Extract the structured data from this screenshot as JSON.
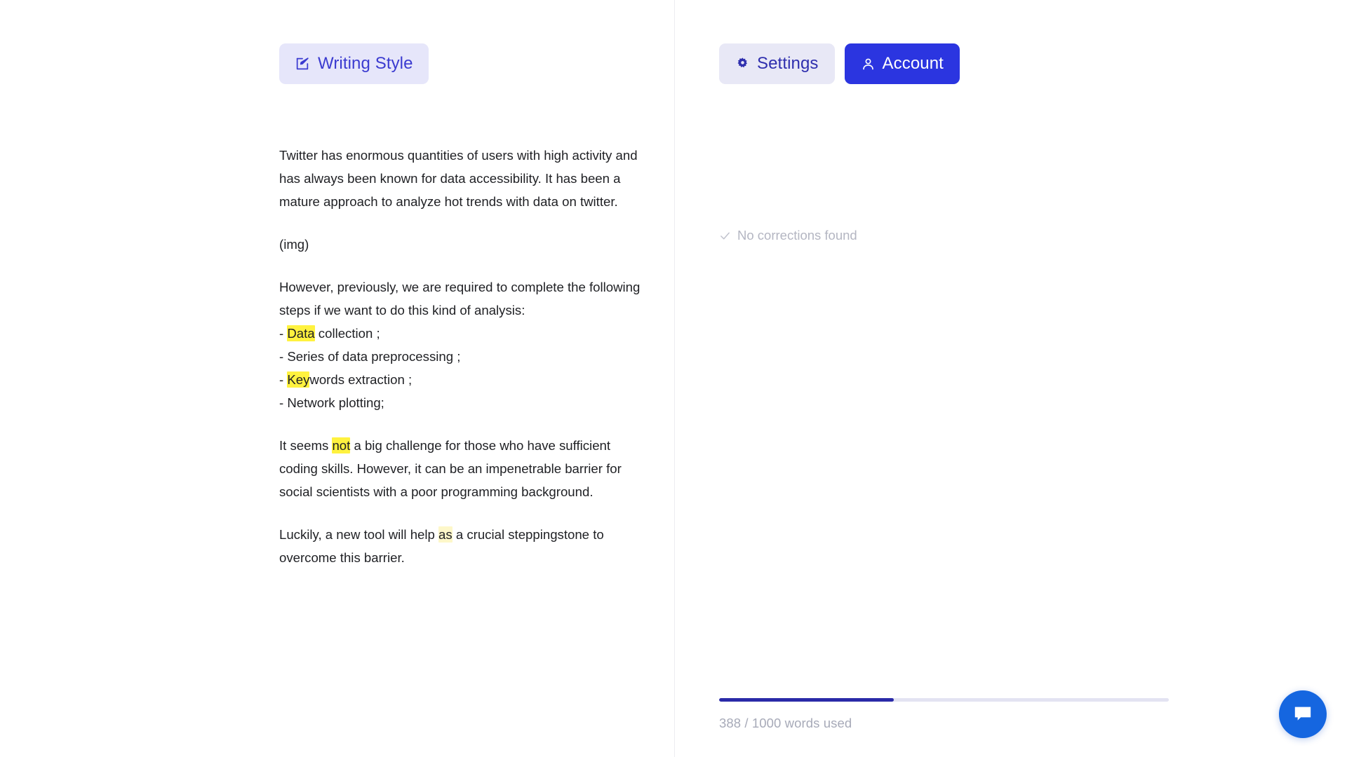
{
  "editor": {
    "writing_style_button": {
      "label": "Writing Style",
      "icon": "edit-square-icon"
    },
    "paragraphs": {
      "p1": "Twitter has enormous quantities of users with high activity and has always been known for data accessibility. It has been a mature approach to analyze hot trends with data on twitter.",
      "p2": "(img)",
      "p3_lead": "However, previously, we are required to complete the following steps if we want to do this kind of analysis:",
      "list": [
        {
          "bullet": "- ",
          "highlight": "Data",
          "rest": " collection ;"
        },
        {
          "bullet": "- ",
          "highlight": "",
          "rest": "Series of data preprocessing ;"
        },
        {
          "bullet": "- ",
          "highlight": "Key",
          "rest": "words extraction ;"
        },
        {
          "bullet": "- ",
          "highlight": "",
          "rest": "Network plotting;"
        }
      ],
      "p4_a": "It seems ",
      "p4_hl": "not",
      "p4_b": " a big challenge for those who have sufficient coding skills. However, it can be an impenetrable barrier for social scientists with a poor programming background.",
      "p5_a": "Luckily, a new tool will help ",
      "p5_hl": "as",
      "p5_b": " a crucial steppingstone to overcome this barrier."
    }
  },
  "sidebar": {
    "settings_button": {
      "label": "Settings",
      "icon": "gear-icon"
    },
    "account_button": {
      "label": "Account",
      "icon": "user-icon"
    },
    "corrections": {
      "label": "No corrections found",
      "icon": "check-icon"
    },
    "usage": {
      "text": "388 / 1000 words used",
      "used": 388,
      "limit": 1000,
      "percent": "38.8%"
    },
    "chat_button": {
      "icon": "chat-bubble-icon"
    }
  },
  "colors": {
    "accent_blue": "#2b35e0",
    "soft_lavender": "#e6e6fa",
    "highlight_yellow": "#fff23f",
    "highlight_soft": "#fdf7c9",
    "progress_fill": "#2a2aa8",
    "chat_blue": "#1566e0",
    "muted_text": "#a7aab8"
  }
}
